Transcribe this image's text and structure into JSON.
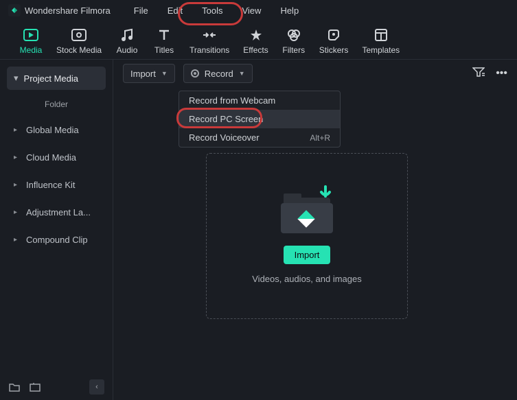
{
  "app": {
    "name": "Wondershare Filmora"
  },
  "menubar": [
    "File",
    "Edit",
    "Tools",
    "View",
    "Help"
  ],
  "toolbar": [
    {
      "label": "Media",
      "active": true
    },
    {
      "label": "Stock Media"
    },
    {
      "label": "Audio"
    },
    {
      "label": "Titles"
    },
    {
      "label": "Transitions"
    },
    {
      "label": "Effects"
    },
    {
      "label": "Filters"
    },
    {
      "label": "Stickers"
    },
    {
      "label": "Templates"
    }
  ],
  "sidebar": {
    "header": "Project Media",
    "folder_label": "Folder",
    "items": [
      "Global Media",
      "Cloud Media",
      "Influence Kit",
      "Adjustment La...",
      "Compound Clip"
    ]
  },
  "subbar": {
    "import_label": "Import",
    "record_label": "Record"
  },
  "record_menu": {
    "items": [
      {
        "label": "Record from Webcam",
        "shortcut": ""
      },
      {
        "label": "Record PC Screen",
        "shortcut": "",
        "hover": true
      },
      {
        "label": "Record Voiceover",
        "shortcut": "Alt+R"
      }
    ]
  },
  "dropzone": {
    "import_btn": "Import",
    "hint": "Videos, audios, and images"
  }
}
